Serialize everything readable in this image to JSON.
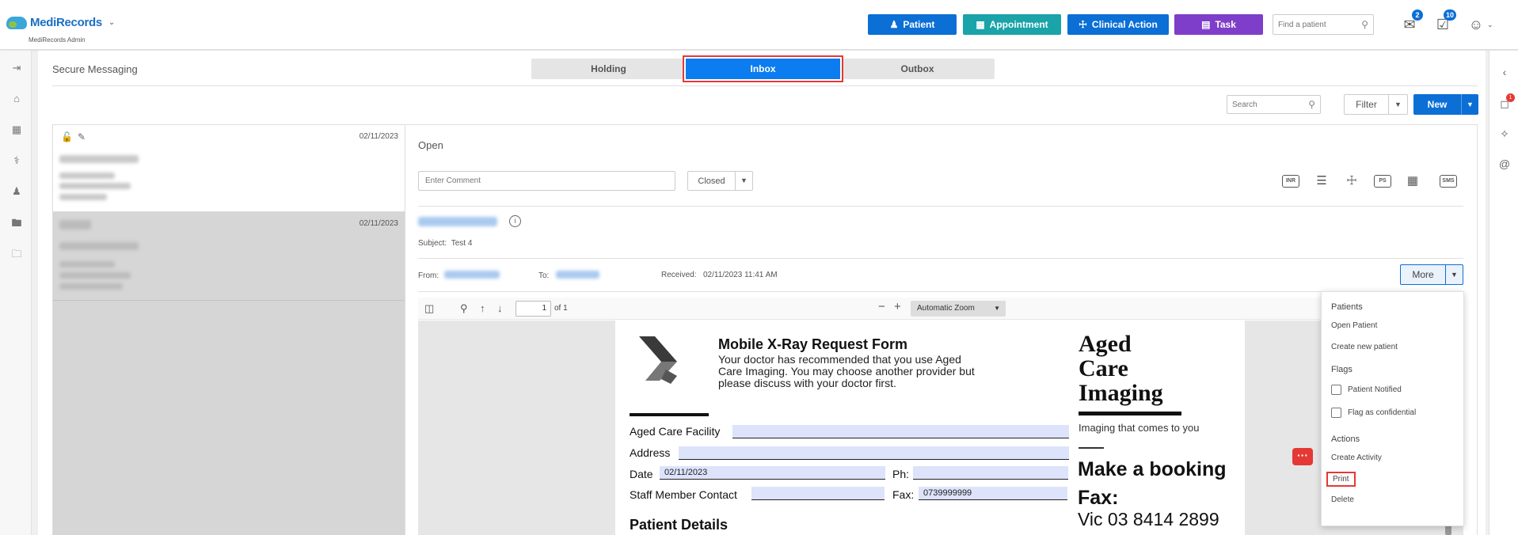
{
  "brand": {
    "name_part1": "Medi",
    "name_part2": "Records",
    "subtitle": "MediRecords Admin"
  },
  "header": {
    "buttons": {
      "patient": "Patient",
      "appointment": "Appointment",
      "clinical_action": "Clinical Action",
      "task": "Task"
    },
    "find_patient_placeholder": "Find a patient",
    "mail_badge": "2",
    "tasks_badge": "10"
  },
  "page": {
    "title": "Secure Messaging"
  },
  "tabs": {
    "holding": "Holding",
    "inbox": "Inbox",
    "outbox": "Outbox"
  },
  "list_toolbar": {
    "search_placeholder": "Search",
    "filter": "Filter",
    "new": "New"
  },
  "messages": [
    {
      "date": "02/11/2023"
    },
    {
      "date": "02/11/2023"
    }
  ],
  "detail": {
    "status": "Open",
    "comment_placeholder": "Enter Comment",
    "state_select": "Closed",
    "tools": {
      "inr": "INR",
      "ps": "PS",
      "sms": "SMS"
    },
    "subject_label": "Subject:",
    "subject_value": "Test 4",
    "from_label": "From:",
    "to_label": "To:",
    "received_label": "Received:",
    "received_value": "02/11/2023 11:41 AM",
    "more": "More"
  },
  "pdf_viewer": {
    "page_number": "1",
    "page_count": "of 1",
    "zoom": "Automatic Zoom"
  },
  "pdf_document": {
    "form_title": "Mobile X-Ray Request Form",
    "intro": "Your doctor has recommended that you use Aged Care Imaging. You may choose another provider but please discuss with your doctor first.",
    "fields": {
      "facility_label": "Aged Care Facility",
      "address_label": "Address",
      "date_label": "Date",
      "date_value": "02/11/2023",
      "ph_label": "Ph:",
      "staff_label": "Staff Member Contact",
      "fax_label": "Fax:",
      "fax_value": "0739999999"
    },
    "provider_line1": "Aged",
    "provider_line2": "Care",
    "provider_line3": "Imaging",
    "tagline": "Imaging that comes to you",
    "booking_title": "Make a booking",
    "fax_title": "Fax:",
    "fax_number": "Vic  03 8414 2899",
    "patient_details": "Patient Details"
  },
  "more_menu": {
    "patients_header": "Patients",
    "open_patient": "Open Patient",
    "create_new_patient": "Create new patient",
    "flags_header": "Flags",
    "patient_notified": "Patient Notified",
    "flag_confidential": "Flag as confidential",
    "actions_header": "Actions",
    "create_activity": "Create Activity",
    "print": "Print",
    "delete": "Delete"
  },
  "right_rail": {
    "chat_badge": "1"
  },
  "colors": {
    "primary": "#0b6fd6",
    "teal": "#1aa3a8",
    "purple": "#7e3ec9",
    "inbox_tab": "#0b7df0",
    "highlight_red": "#e53935"
  }
}
